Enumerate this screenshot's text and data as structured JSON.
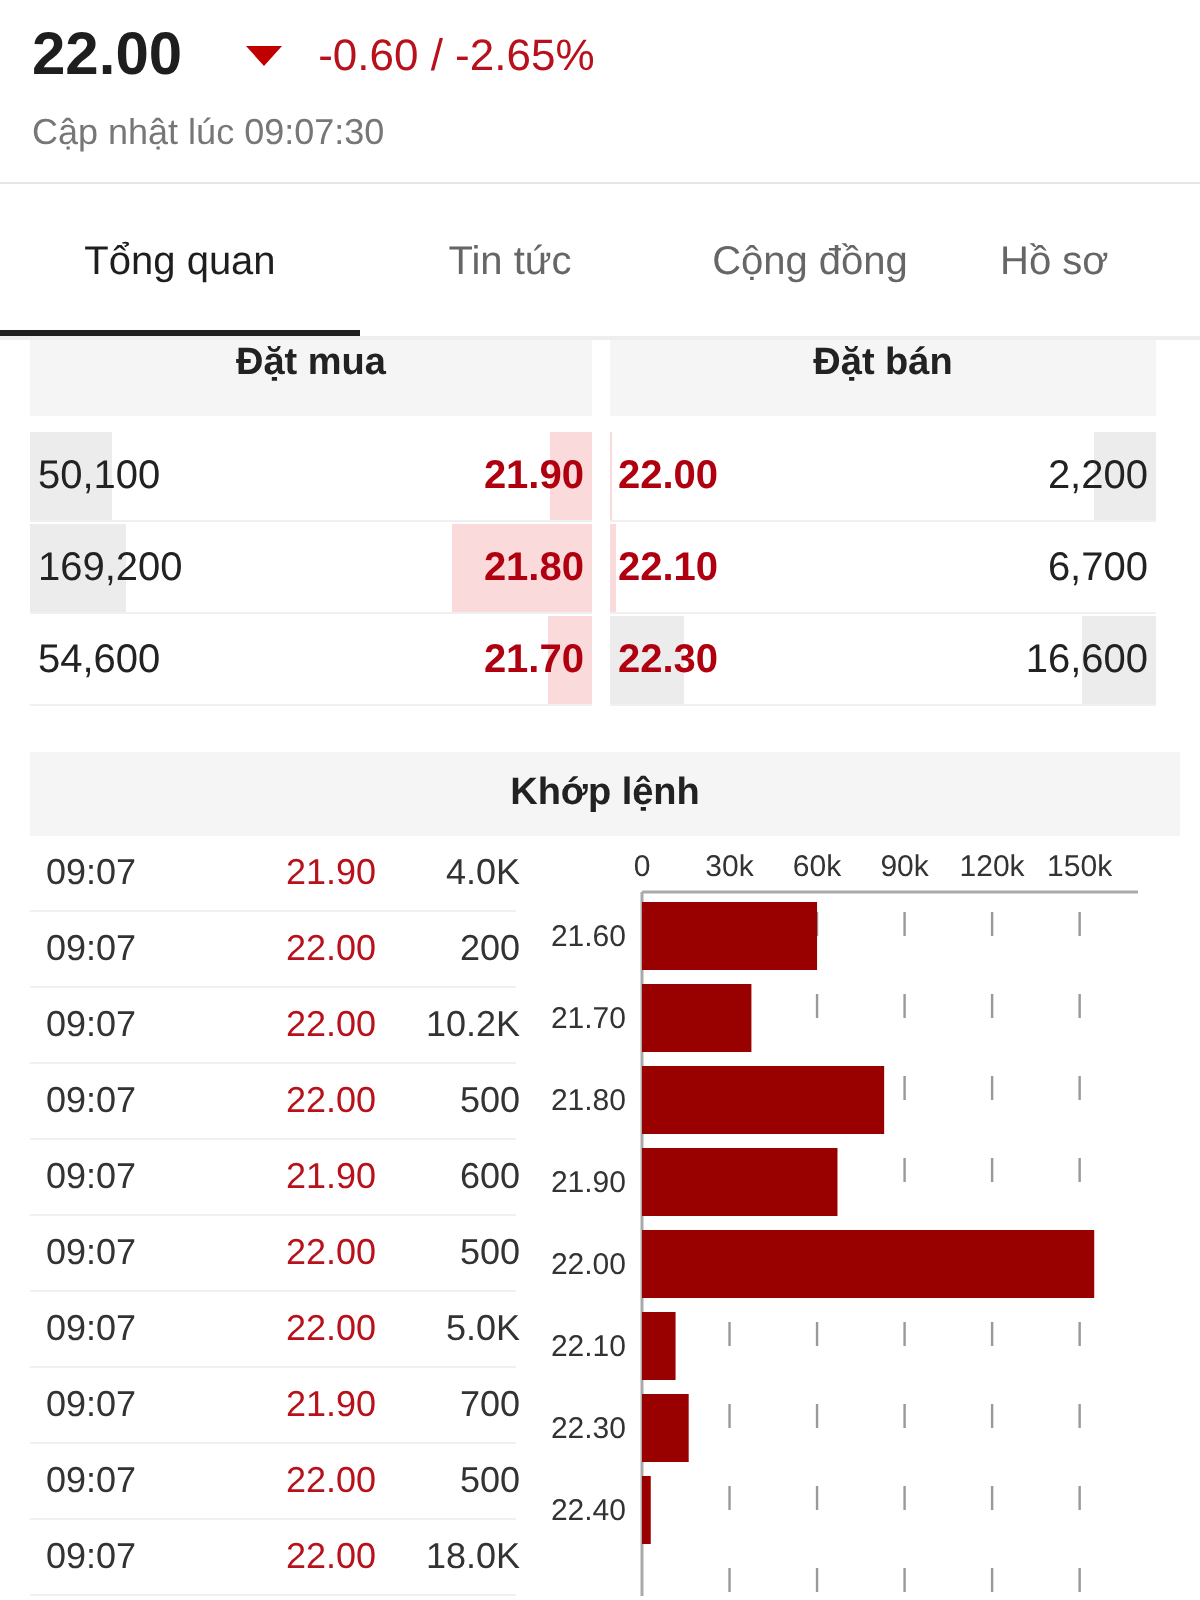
{
  "quote": {
    "price": "22.00",
    "down": true,
    "change": "-0.60 / -2.65%",
    "updated": "Cập nhật lúc 09:07:30"
  },
  "tabs": [
    {
      "label": "Tổng quan",
      "selected": true
    },
    {
      "label": "Tin tức",
      "selected": false
    },
    {
      "label": "Cộng đồng",
      "selected": false
    },
    {
      "label": "Hồ sơ",
      "selected": false
    }
  ],
  "order_book": {
    "bid_title": "Đặt mua",
    "ask_title": "Đặt bán",
    "bids": [
      {
        "volume": "50,100",
        "price": "21.90",
        "volume_bar": {
          "level": 0.29
        },
        "price_bar": {
          "level": 0.15
        }
      },
      {
        "volume": "169,200",
        "price": "21.80",
        "volume_bar": {
          "level": 0.34
        },
        "price_bar": {
          "level": 0.5
        }
      },
      {
        "volume": "54,600",
        "price": "21.70",
        "price_bar": {
          "level": 0.16
        }
      }
    ],
    "asks": [
      {
        "price": "22.00",
        "volume": "2,200",
        "price_bar": {
          "level": 0.01
        },
        "volume_bar": {
          "level": 0.23
        }
      },
      {
        "price": "22.10",
        "volume": "6,700",
        "price_bar": {
          "level": 0.02
        }
      },
      {
        "price": "22.30",
        "volume": "16,600",
        "price_bar": {
          "level": 0.27
        },
        "volume_bar": {
          "level": 0.27
        }
      }
    ]
  },
  "matches": {
    "title": "Khớp lệnh",
    "trades": [
      {
        "time": "09:07",
        "price": "21.90",
        "volume": "4.0K"
      },
      {
        "time": "09:07",
        "price": "22.00",
        "volume": "200"
      },
      {
        "time": "09:07",
        "price": "22.00",
        "volume": "10.2K"
      },
      {
        "time": "09:07",
        "price": "22.00",
        "volume": "500"
      },
      {
        "time": "09:07",
        "price": "21.90",
        "volume": "600"
      },
      {
        "time": "09:07",
        "price": "22.00",
        "volume": "500"
      },
      {
        "time": "09:07",
        "price": "22.00",
        "volume": "5.0K"
      },
      {
        "time": "09:07",
        "price": "21.90",
        "volume": "700"
      },
      {
        "time": "09:07",
        "price": "22.00",
        "volume": "500"
      },
      {
        "time": "09:07",
        "price": "22.00",
        "volume": "18.0K"
      }
    ],
    "chart_data": {
      "type": "bar",
      "orientation": "horizontal",
      "categories": [
        "21.60",
        "21.70",
        "21.80",
        "21.90",
        "22.00",
        "22.10",
        "22.30",
        "22.40"
      ],
      "grid": true,
      "series": [
        {
          "color": "#990000",
          "values": [
            60000,
            37500,
            83000,
            67000,
            155000,
            11500,
            16000,
            3000
          ]
        }
      ],
      "xlim": [
        0,
        170000
      ],
      "xticks": [
        {
          "value": 0,
          "label": "0"
        },
        {
          "value": 30000,
          "label": "30k"
        },
        {
          "value": 60000,
          "label": "60k"
        },
        {
          "value": 90000,
          "label": "90k"
        },
        {
          "value": 120000,
          "label": "120k"
        },
        {
          "value": 150000,
          "label": "150k"
        }
      ]
    }
  }
}
